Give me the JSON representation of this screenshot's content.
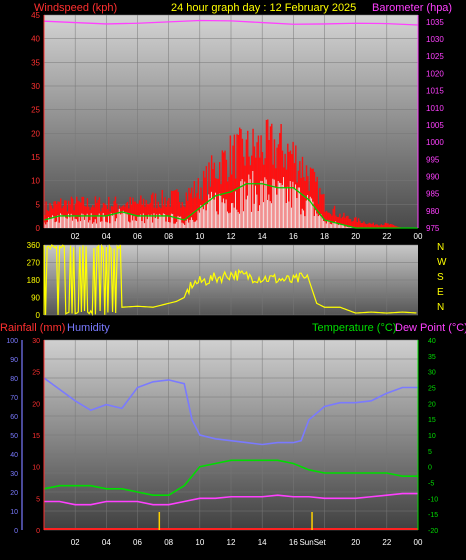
{
  "header": {
    "left_label": "Windspeed (kph)",
    "center_title": "24 hour graph day : 12 February 2025",
    "right_label": "Barometer (hpa)"
  },
  "colors": {
    "wind_label": "#ff3030",
    "title": "#ffff00",
    "baro": "#ff40ff",
    "rain": "#ff3030",
    "humidity": "#7a7aff",
    "temp": "#00dd00",
    "dew": "#ff40ff",
    "dir": "#ffff00",
    "x_ticks": "#ffffff"
  },
  "x_ticks": [
    "02",
    "04",
    "06",
    "08",
    "10",
    "12",
    "14",
    "16",
    "18",
    "20",
    "22",
    "00"
  ],
  "sun_labels": [
    "Sun",
    "Set"
  ],
  "panel1": {
    "wind_ticks": [
      "0",
      "5",
      "10",
      "15",
      "20",
      "25",
      "30",
      "35",
      "40",
      "45"
    ],
    "baro_ticks": [
      "975",
      "980",
      "985",
      "990",
      "995",
      "1000",
      "1005",
      "1010",
      "1015",
      "1020",
      "1025",
      "1030",
      "1035"
    ]
  },
  "panel2": {
    "deg_ticks": [
      "0",
      "90",
      "180",
      "270",
      "360"
    ],
    "compass": [
      "N",
      "W",
      "S",
      "E",
      "N"
    ]
  },
  "panel3": {
    "rain_label": "Rainfall (mm)",
    "humidity_label": "Humidity",
    "temp_label": "Temperature (°C)",
    "dew_label": "Dew Point (°C)",
    "humidity_ticks": [
      "0",
      "10",
      "20",
      "30",
      "40",
      "50",
      "60",
      "70",
      "80",
      "90",
      "100"
    ],
    "rain_ticks": [
      "0",
      "5",
      "10",
      "15",
      "20",
      "25",
      "30"
    ],
    "temp_ticks": [
      "-20",
      "-15",
      "-10",
      "-5",
      "0",
      "5",
      "10",
      "15",
      "20",
      "25",
      "30",
      "35",
      "40"
    ]
  },
  "chart_data": [
    {
      "type": "line",
      "title": "24 hour graph day : 12 February 2025",
      "x_unit": "hour",
      "xlim": [
        0,
        24
      ],
      "series": [
        {
          "name": "Windspeed (kph)",
          "axis": "left",
          "ylim": [
            0,
            45
          ],
          "x": [
            0,
            1,
            2,
            3,
            4,
            5,
            6,
            7,
            8,
            9,
            10,
            11,
            12,
            13,
            14,
            15,
            16,
            17,
            18,
            19,
            20,
            21,
            22,
            23,
            24
          ],
          "values": [
            2,
            3,
            3,
            3,
            3,
            4,
            3,
            3,
            3,
            2,
            5,
            8,
            9,
            11,
            11,
            10,
            10,
            7,
            2,
            1,
            0,
            0,
            0,
            0,
            0
          ]
        },
        {
          "name": "Gust (kph)",
          "axis": "left",
          "ylim": [
            0,
            45
          ],
          "x": [
            0,
            1,
            2,
            3,
            4,
            5,
            6,
            7,
            8,
            9,
            10,
            11,
            12,
            13,
            14,
            15,
            16,
            17,
            18,
            19,
            20,
            21,
            22,
            23,
            24
          ],
          "values": [
            5,
            6,
            6,
            6,
            6,
            6,
            6,
            7,
            7,
            8,
            10,
            15,
            18,
            19,
            20,
            20,
            18,
            13,
            6,
            3,
            2,
            1,
            1,
            0,
            0
          ]
        },
        {
          "name": "Barometer (hpa)",
          "axis": "right",
          "ylim": [
            975,
            1037
          ],
          "x": [
            0,
            2,
            4,
            6,
            8,
            10,
            12,
            14,
            16,
            18,
            20,
            22,
            24
          ],
          "values": [
            1035.2,
            1034.8,
            1034.4,
            1034.6,
            1035.0,
            1035.4,
            1035.3,
            1034.8,
            1034.3,
            1034.4,
            1034.6,
            1034.5,
            1034.1
          ]
        }
      ]
    },
    {
      "type": "scatter",
      "x_unit": "hour",
      "xlim": [
        0,
        24
      ],
      "ylim": [
        0,
        360
      ],
      "series": [
        {
          "x": [
            0,
            0.5,
            1,
            1.5,
            2,
            2.3,
            2.7,
            3,
            3.5,
            4,
            5,
            6,
            7,
            8,
            8.5,
            9,
            9.5,
            10,
            11,
            12,
            13,
            14,
            15,
            16,
            16.5,
            17,
            17.5,
            18,
            19,
            20,
            21,
            22,
            23,
            24
          ],
          "values": [
            350,
            330,
            20,
            340,
            10,
            345,
            15,
            320,
            40,
            40,
            40,
            45,
            40,
            60,
            70,
            90,
            160,
            170,
            190,
            210,
            200,
            190,
            185,
            175,
            190,
            180,
            60,
            40,
            40,
            10,
            15,
            10,
            15,
            10
          ]
        }
      ]
    },
    {
      "type": "line",
      "x_unit": "hour",
      "xlim": [
        0,
        24
      ],
      "series": [
        {
          "name": "Humidity",
          "axis": "humidity",
          "ylim": [
            0,
            100
          ],
          "x": [
            0,
            1,
            2,
            3,
            4,
            5,
            6,
            7,
            8,
            9,
            9.5,
            10,
            11,
            12,
            13,
            14,
            15,
            16,
            16.5,
            17,
            18,
            19,
            20,
            21,
            22,
            23,
            24
          ],
          "values": [
            80,
            74,
            68,
            63,
            66,
            64,
            75,
            78,
            79,
            77,
            58,
            50,
            48,
            47,
            46,
            45,
            46,
            46,
            47,
            58,
            65,
            67,
            67,
            68,
            72,
            75,
            75
          ]
        },
        {
          "name": "Temperature (°C)",
          "axis": "temp",
          "ylim": [
            -20,
            40
          ],
          "x": [
            0,
            1,
            2,
            3,
            4,
            5,
            6,
            7,
            8,
            9,
            10,
            11,
            12,
            13,
            14,
            15,
            16,
            17,
            18,
            19,
            20,
            21,
            22,
            23,
            24
          ],
          "values": [
            -7,
            -6,
            -6,
            -6,
            -7,
            -7,
            -8,
            -9,
            -9,
            -6,
            0,
            1,
            2,
            2,
            2,
            2,
            1,
            -1,
            -2,
            -2,
            -2,
            -2,
            -2,
            -3,
            -3
          ]
        },
        {
          "name": "Dew Point (°C)",
          "axis": "temp",
          "ylim": [
            -20,
            40
          ],
          "x": [
            0,
            1,
            2,
            3,
            4,
            5,
            6,
            7,
            8,
            9,
            10,
            11,
            12,
            13,
            14,
            15,
            16,
            17,
            18,
            19,
            20,
            21,
            22,
            23,
            24
          ],
          "values": [
            -11,
            -11,
            -12,
            -12,
            -11,
            -11,
            -11,
            -12,
            -12,
            -11,
            -10,
            -10,
            -9.5,
            -9.5,
            -9.5,
            -9,
            -9.5,
            -9.5,
            -10,
            -10,
            -10,
            -9.5,
            -9,
            -8.5,
            -8.5
          ]
        },
        {
          "name": "Rainfall (mm)",
          "axis": "rain",
          "ylim": [
            0,
            30
          ],
          "x": [
            0,
            24
          ],
          "values": [
            0,
            0
          ]
        }
      ]
    }
  ]
}
